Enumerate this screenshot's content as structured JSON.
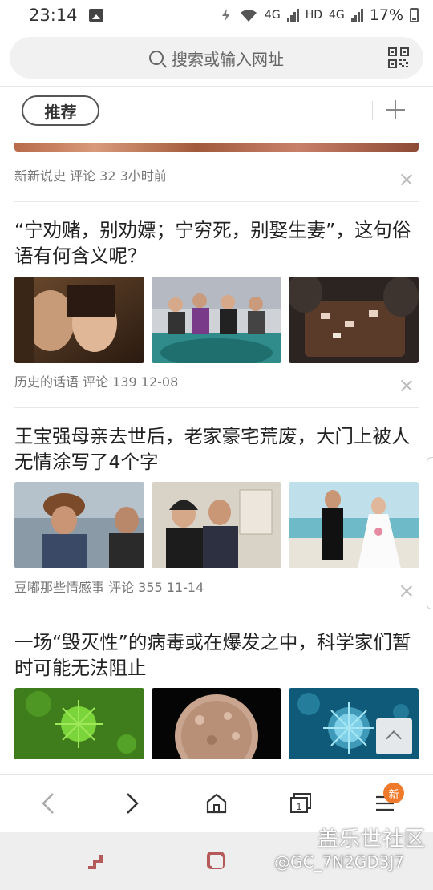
{
  "status_bar": {
    "time": "23:14",
    "network_a": "4G",
    "hd": "HD",
    "network_b": "4G",
    "battery": "17%"
  },
  "search": {
    "placeholder": "搜索或输入网址"
  },
  "channel": {
    "active_tab": "推荐"
  },
  "feed": {
    "top_item_meta": "新新说史 评论 32 3小时前",
    "items": [
      {
        "title": "“宁劝赌，别劝嫖；宁穷死，别娶生妻”，这句俗语有何含义呢？",
        "meta": "历史的话语 评论 139 12-08"
      },
      {
        "title": "王宝强母亲去世后，老家豪宅荒废，大门上被人无情涂写了4个字",
        "meta": "豆嘟那些情感事 评论 355 11-14"
      },
      {
        "title": "一场“毁灭性”的病毒或在爆发之中，科学家们暂时可能无法阻止",
        "meta": ""
      }
    ]
  },
  "bottom_nav": {
    "menu_badge": "新"
  },
  "watermark": {
    "title": "盖乐世社区",
    "user": "@GC_7N2GD3J7"
  }
}
